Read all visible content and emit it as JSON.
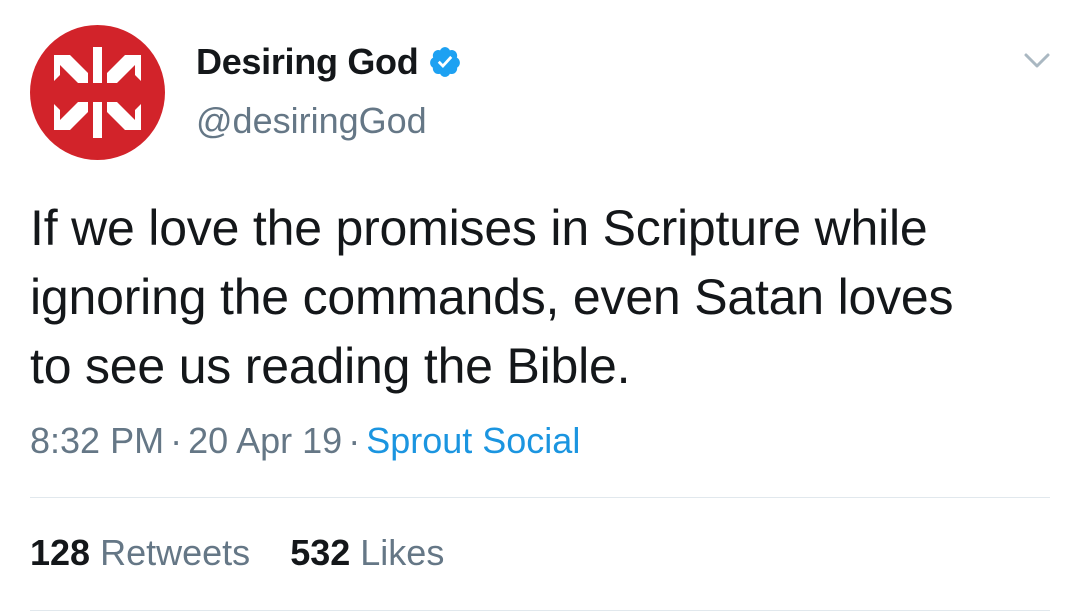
{
  "colors": {
    "avatar_bg": "#d2232a",
    "verified": "#1da1f2",
    "link": "#1b95e0",
    "muted": "#657786",
    "text": "#14171a"
  },
  "account": {
    "display_name": "Desiring God",
    "handle": "@desiringGod",
    "verified": true,
    "avatar_icon": "desiring-god-logo-icon",
    "menu_icon": "chevron-down-icon"
  },
  "tweet": {
    "lines": [
      "If we love the promises in Scripture while",
      "ignoring the commands, even Satan loves",
      "to see us reading the Bible."
    ],
    "time": "8:32 PM",
    "date": "20 Apr 19",
    "separator": "·",
    "source": "Sprout Social"
  },
  "stats": {
    "retweets_count": "128",
    "retweets_label": "Retweets",
    "likes_count": "532",
    "likes_label": "Likes"
  }
}
